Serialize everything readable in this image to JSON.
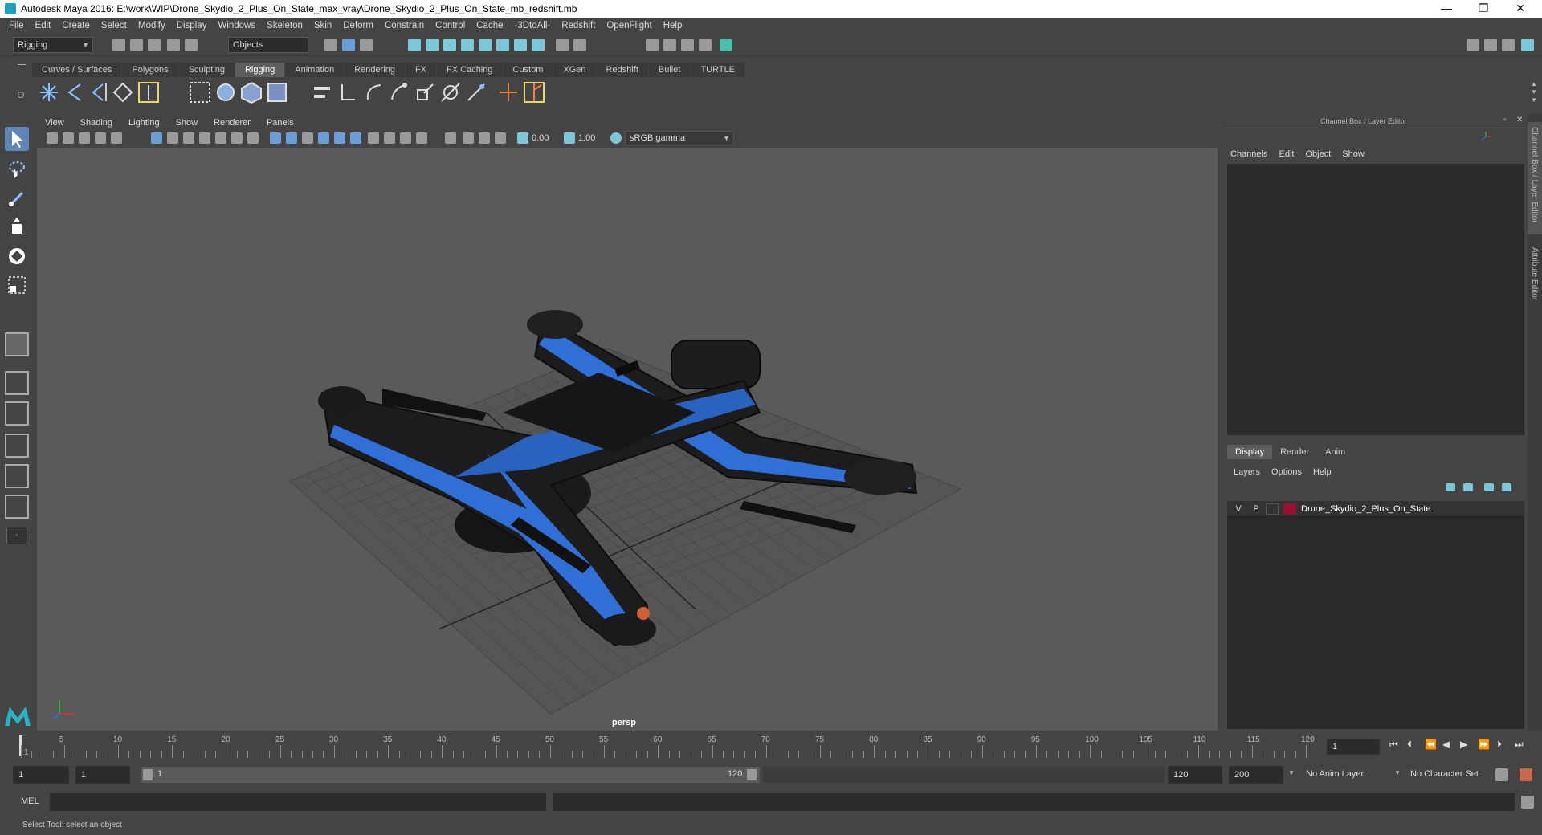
{
  "window": {
    "title": "Autodesk Maya 2016: E:\\work\\WIP\\Drone_Skydio_2_Plus_On_State_max_vray\\Drone_Skydio_2_Plus_On_State_mb_redshift.mb",
    "minimize": "—",
    "maximize": "❐",
    "close": "✕"
  },
  "menubar": [
    "File",
    "Edit",
    "Create",
    "Select",
    "Modify",
    "Display",
    "Windows",
    "Skeleton",
    "Skin",
    "Deform",
    "Constrain",
    "Control",
    "Cache",
    "-3DtoAll-",
    "Redshift",
    "OpenFlight",
    "Help"
  ],
  "statusline": {
    "mode": "Rigging",
    "selection_mode": "Objects"
  },
  "shelf_tabs": [
    "Curves / Surfaces",
    "Polygons",
    "Sculpting",
    "Rigging",
    "Animation",
    "Rendering",
    "FX",
    "FX Caching",
    "Custom",
    "XGen",
    "Redshift",
    "Bullet",
    "TURTLE"
  ],
  "active_shelf": "Rigging",
  "viewport": {
    "menus": [
      "View",
      "Shading",
      "Lighting",
      "Show",
      "Renderer",
      "Panels"
    ],
    "exposure": "0.00",
    "gamma": "1.00",
    "color_space": "sRGB gamma",
    "camera_label": "persp"
  },
  "channel_box": {
    "title": "Channel Box / Layer Editor",
    "menus": [
      "Channels",
      "Edit",
      "Object",
      "Show"
    ],
    "layer_tabs": [
      "Display",
      "Render",
      "Anim"
    ],
    "active_layer_tab": "Display",
    "layer_menus": [
      "Layers",
      "Options",
      "Help"
    ],
    "layers": [
      {
        "visible": "V",
        "playback": "P",
        "name": "Drone_Skydio_2_Plus_On_State",
        "color": "#9a1030"
      }
    ]
  },
  "side_tabs": [
    "Channel Box / Layer Editor",
    "Attribute Editor"
  ],
  "timeline": {
    "ticks": [
      1,
      5,
      10,
      15,
      20,
      25,
      30,
      35,
      40,
      45,
      50,
      55,
      60,
      65,
      70,
      75,
      80,
      85,
      90,
      95,
      100,
      105,
      110,
      115,
      120
    ],
    "start": 1,
    "end": 120,
    "current_frame": "1"
  },
  "range": {
    "start": "1",
    "playback_start": "1",
    "slider_start": "1",
    "slider_end": "120",
    "playback_end": "120",
    "end": "200",
    "anim_layer": "No Anim Layer",
    "character_set": "No Character Set"
  },
  "command_line": {
    "label": "MEL"
  },
  "help_line": "Select Tool: select an object"
}
